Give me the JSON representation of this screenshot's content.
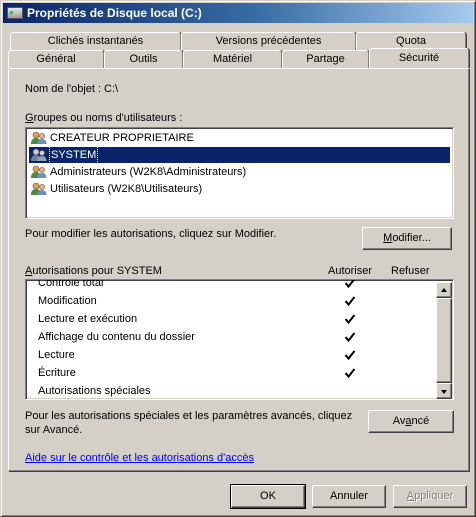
{
  "window": {
    "title": "Propriétés de Disque local (C:)"
  },
  "tabs": {
    "row1": [
      "Clichés instantanés",
      "Versions précédentes",
      "Quota"
    ],
    "row2": [
      "Général",
      "Outils",
      "Matériel",
      "Partage",
      "Sécurité"
    ],
    "active": "Sécurité"
  },
  "object": {
    "label": "Nom de l'objet :",
    "value": "C:\\"
  },
  "groups": {
    "label": "Groupes ou noms d'utilisateurs :",
    "items": [
      "CREATEUR PROPRIETAIRE",
      "SYSTEM",
      "Administrateurs (W2K8\\Administrateurs)",
      "Utilisateurs (W2K8\\Utilisateurs)"
    ],
    "selected_index": 1
  },
  "modify": {
    "info": "Pour modifier les autorisations, cliquez sur Modifier.",
    "button": "Modifier..."
  },
  "permissions": {
    "label": "Autorisations pour SYSTEM",
    "col_allow": "Autoriser",
    "col_deny": "Refuser",
    "rows": [
      {
        "name": "Contrôle total",
        "allow": true,
        "deny": false
      },
      {
        "name": "Modification",
        "allow": true,
        "deny": false
      },
      {
        "name": "Lecture et exécution",
        "allow": true,
        "deny": false
      },
      {
        "name": "Affichage du contenu du dossier",
        "allow": true,
        "deny": false
      },
      {
        "name": "Lecture",
        "allow": true,
        "deny": false
      },
      {
        "name": "Écriture",
        "allow": true,
        "deny": false
      },
      {
        "name": "Autorisations spéciales",
        "allow": false,
        "deny": false
      }
    ]
  },
  "advanced": {
    "info_line1": "Pour les autorisations spéciales et les paramètres avancés, cliquez",
    "info_line2": "sur Avancé.",
    "button": "Avancé"
  },
  "help_link": "Aide sur le contrôle et les autorisations d'accès",
  "footer": {
    "ok": "OK",
    "cancel": "Annuler",
    "apply": "Appliquer"
  },
  "colors": {
    "face": "#d4d0c8",
    "selection": "#0a246a",
    "link": "#0000ff"
  }
}
